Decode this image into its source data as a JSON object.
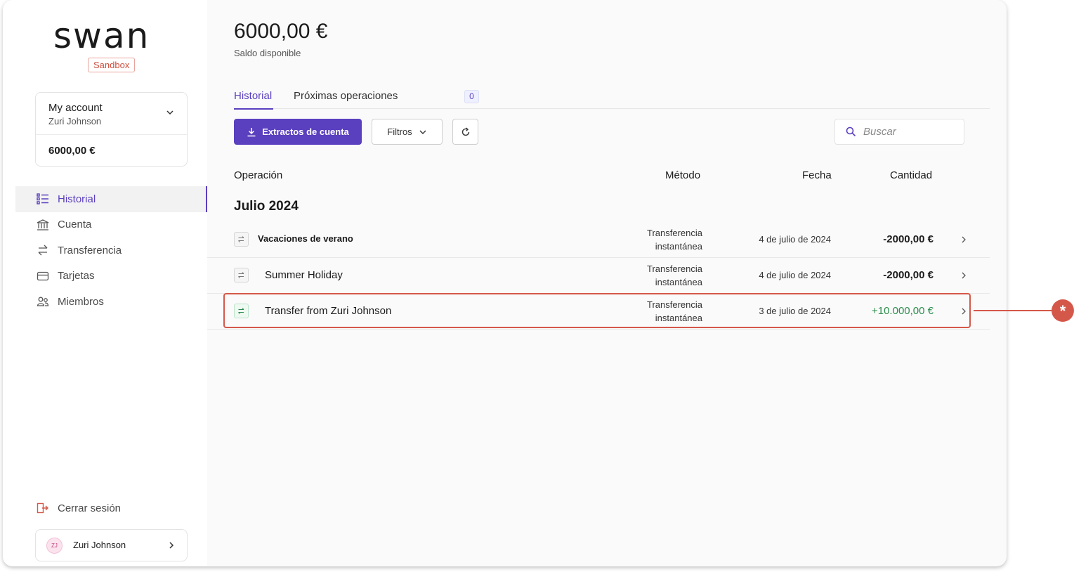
{
  "brand": {
    "logo_text": "swan",
    "env_badge": "Sandbox"
  },
  "account": {
    "title": "My account",
    "holder": "Zuri Johnson",
    "balance": "6000,00 €"
  },
  "nav": [
    {
      "label": "Historial",
      "icon": "list-icon",
      "active": true
    },
    {
      "label": "Cuenta",
      "icon": "bank-icon",
      "active": false
    },
    {
      "label": "Transferencia",
      "icon": "transfer-icon",
      "active": false
    },
    {
      "label": "Tarjetas",
      "icon": "card-icon",
      "active": false
    },
    {
      "label": "Miembros",
      "icon": "members-icon",
      "active": false
    }
  ],
  "logout": {
    "label": "Cerrar sesión"
  },
  "user": {
    "initials": "ZJ",
    "name": "Zuri Johnson"
  },
  "main": {
    "balance": "6000,00 €",
    "balance_label": "Saldo disponible",
    "tabs": [
      {
        "label": "Historial",
        "active": true
      },
      {
        "label": "Próximas operaciones",
        "count": "0"
      }
    ],
    "toolbar": {
      "statements_label": "Extractos de cuenta",
      "filters_label": "Filtros",
      "search_placeholder": "Buscar"
    },
    "table": {
      "headers": {
        "operation": "Operación",
        "method": "Método",
        "date": "Fecha",
        "amount": "Cantidad"
      },
      "group": "Julio 2024",
      "rows": [
        {
          "name": "Vacaciones de verano",
          "method_line1": "Transferencia",
          "method_line2": "instantánea",
          "date": "4 de julio de 2024",
          "amount": "-2000,00 €",
          "positive": false
        },
        {
          "name": "Summer Holiday",
          "method_line1": "Transferencia",
          "method_line2": "instantánea",
          "date": "4 de julio de 2024",
          "amount": "-2000,00 €",
          "positive": false
        },
        {
          "name": "Transfer from Zuri Johnson",
          "method_line1": "Transferencia",
          "method_line2": "instantánea",
          "date": "3 de julio de 2024",
          "amount": "+10.000,00 €",
          "positive": true
        }
      ]
    }
  },
  "colors": {
    "accent": "#5a3fbf",
    "positive": "#2b8c4d",
    "highlight": "#d4584a"
  },
  "callout": {
    "symbol": "*"
  }
}
